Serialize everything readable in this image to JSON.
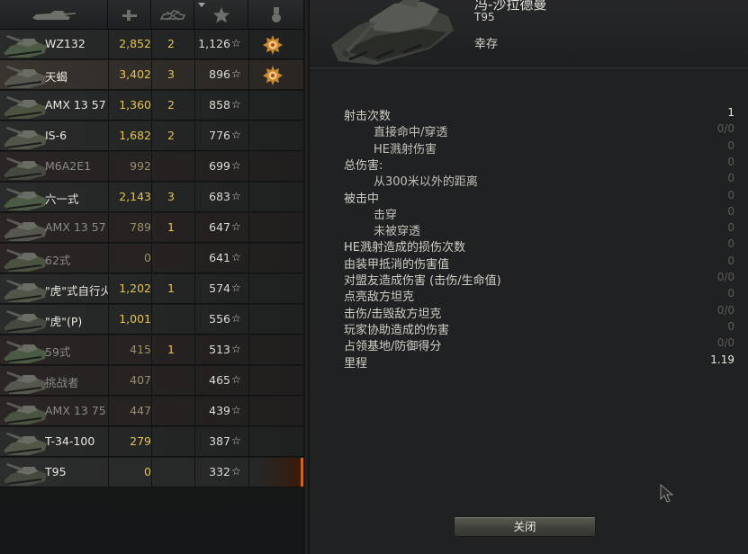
{
  "roster": [
    {
      "name": "WZ132",
      "damage": "2,852",
      "kills": "2",
      "xp": "1,126",
      "medal": true,
      "state": "alive"
    },
    {
      "name": "天蝎",
      "damage": "3,402",
      "kills": "3",
      "xp": "896",
      "medal": true,
      "state": "highlight"
    },
    {
      "name": "AMX 13 57",
      "damage": "1,360",
      "kills": "2",
      "xp": "858",
      "medal": false,
      "state": "alive"
    },
    {
      "name": "IS-6",
      "damage": "1,682",
      "kills": "2",
      "xp": "776",
      "medal": false,
      "state": "alive"
    },
    {
      "name": "M6A2E1",
      "damage": "992",
      "kills": "",
      "xp": "699",
      "medal": false,
      "state": "dead"
    },
    {
      "name": "六一式",
      "damage": "2,143",
      "kills": "3",
      "xp": "683",
      "medal": false,
      "state": "alive"
    },
    {
      "name": "AMX 13 57",
      "damage": "789",
      "kills": "1",
      "xp": "647",
      "medal": false,
      "state": "dead"
    },
    {
      "name": "62式",
      "damage": "0",
      "kills": "",
      "xp": "641",
      "medal": false,
      "state": "dead"
    },
    {
      "name": "\"虎\"式自行火",
      "damage": "1,202",
      "kills": "1",
      "xp": "574",
      "medal": false,
      "state": "alive"
    },
    {
      "name": "\"虎\"(P)",
      "damage": "1,001",
      "kills": "",
      "xp": "556",
      "medal": false,
      "state": "alive"
    },
    {
      "name": "59式",
      "damage": "415",
      "kills": "1",
      "xp": "513",
      "medal": false,
      "state": "dead"
    },
    {
      "name": "挑战者",
      "damage": "407",
      "kills": "",
      "xp": "465",
      "medal": false,
      "state": "dead"
    },
    {
      "name": "AMX 13 75",
      "damage": "447",
      "kills": "",
      "xp": "439",
      "medal": false,
      "state": "dead"
    },
    {
      "name": "T-34-100",
      "damage": "279",
      "kills": "",
      "xp": "387",
      "medal": false,
      "state": "alive"
    },
    {
      "name": "T95",
      "damage": "0",
      "kills": "",
      "xp": "332",
      "medal": false,
      "state": "self"
    }
  ],
  "star_glyph": "☆",
  "header": {
    "icons": [
      "tank-icon",
      "damage-icon",
      "kills-icon",
      "sort-chevron-icon",
      "star-icon",
      "medal-icon"
    ]
  },
  "detail": {
    "player_name": "冯-沙拉德曼",
    "vehicle": "T95",
    "status": "幸存",
    "stats": [
      {
        "label": "射击次数",
        "value": "1",
        "indent": false,
        "bright": true
      },
      {
        "label": "直接命中/穿透",
        "value": "0/0",
        "indent": true,
        "bright": false
      },
      {
        "label": "HE溅射伤害",
        "value": "0",
        "indent": true,
        "bright": false
      },
      {
        "label": "总伤害:",
        "value": "0",
        "indent": false,
        "bright": false
      },
      {
        "label": "从300米以外的距离",
        "value": "0",
        "indent": true,
        "bright": false
      },
      {
        "label": "被击中",
        "value": "0",
        "indent": false,
        "bright": false
      },
      {
        "label": "击穿",
        "value": "0",
        "indent": true,
        "bright": false
      },
      {
        "label": "未被穿透",
        "value": "0",
        "indent": true,
        "bright": false
      },
      {
        "label": "HE溅射造成的损伤次数",
        "value": "0",
        "indent": false,
        "bright": false
      },
      {
        "label": "由装甲抵消的伤害值",
        "value": "0",
        "indent": false,
        "bright": false
      },
      {
        "label": "对盟友造成伤害 (击伤/生命值)",
        "value": "0/0",
        "indent": false,
        "bright": false
      },
      {
        "label": "点亮敌方坦克",
        "value": "0",
        "indent": false,
        "bright": false
      },
      {
        "label": "击伤/击毁敌方坦克",
        "value": "0/0",
        "indent": false,
        "bright": false
      },
      {
        "label": "玩家协助造成的伤害",
        "value": "0",
        "indent": false,
        "bright": false
      },
      {
        "label": "占领基地/防御得分",
        "value": "0/0",
        "indent": false,
        "bright": false
      },
      {
        "label": "里程",
        "value": "1.19",
        "indent": false,
        "bright": true
      }
    ],
    "close_label": "关闭"
  },
  "colors": {
    "damage": "#e2c34f",
    "self_accent": "#d4651c",
    "medal": "#c9872e"
  }
}
